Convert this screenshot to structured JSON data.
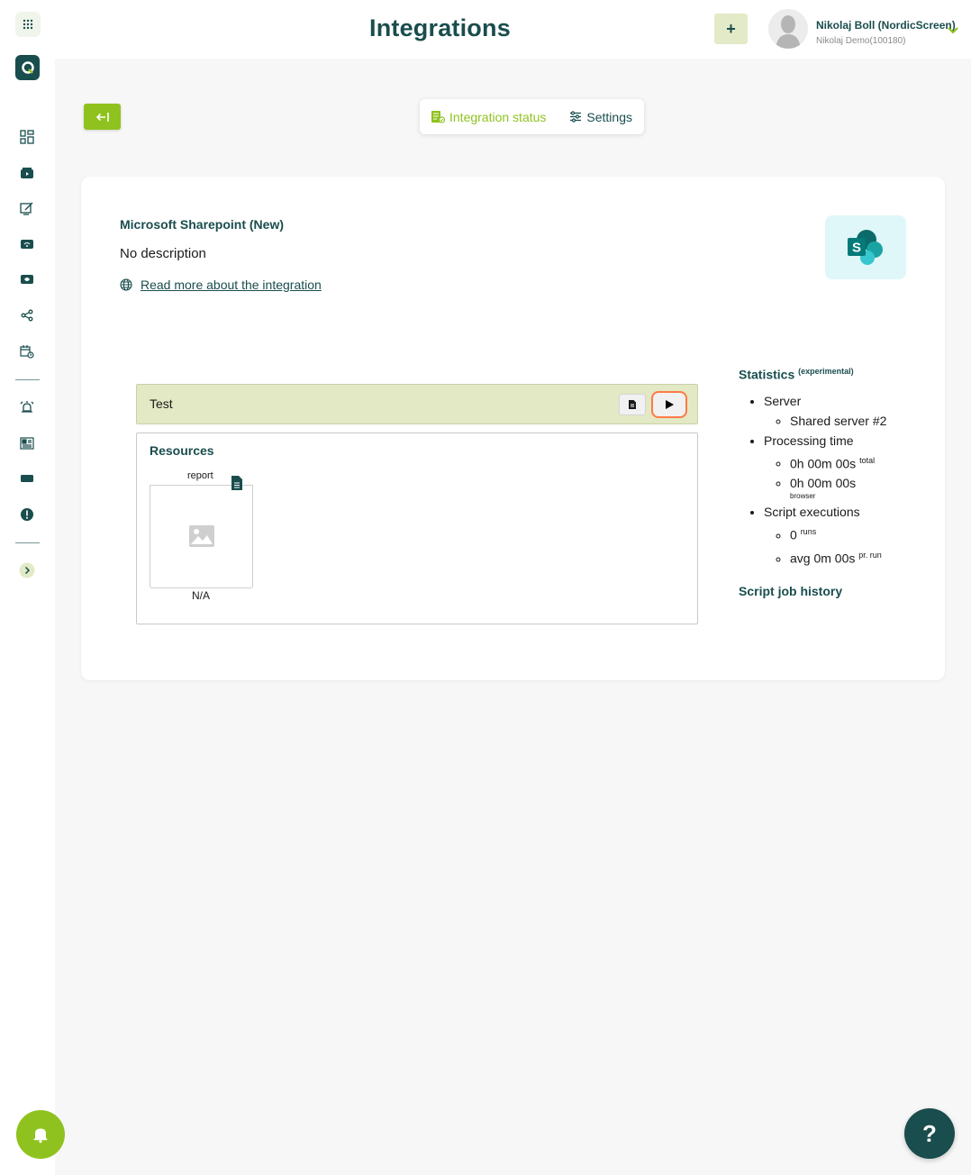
{
  "header": {
    "title": "Integrations",
    "add_label": "+",
    "user_name": "Nikolaj Boll (NordicScreen)",
    "user_org": "Nikolaj Demo(100180)"
  },
  "tabs": [
    {
      "label": "Integration status",
      "active": true
    },
    {
      "label": "Settings",
      "active": false
    }
  ],
  "integration": {
    "title": "Microsoft Sharepoint (New)",
    "description": "No description",
    "link_text": "Read more about the integration"
  },
  "test": {
    "label": "Test"
  },
  "resources": {
    "title": "Resources",
    "item_label": "report",
    "item_value": "N/A"
  },
  "stats": {
    "title": "Statistics",
    "title_sup": "(experimental)",
    "server_label": "Server",
    "server_value": "Shared server #2",
    "processing_label": "Processing time",
    "total_time": "0h 00m 00s",
    "total_sup": "total",
    "browser_time": "0h 00m 00s",
    "browser_note": "browser",
    "executions_label": "Script executions",
    "runs_value": "0",
    "runs_sup": "runs",
    "avg_value": "avg 0m 00s",
    "avg_sup": "pr. run",
    "history_link": "Script job history"
  },
  "help": {
    "label": "?"
  },
  "colors": {
    "brand_dark": "#1a4d4d",
    "brand_green": "#8fc21f",
    "highlight": "#ff7a45"
  },
  "icons": [
    "apps-grid-icon",
    "logo-icon",
    "dashboard-icon",
    "media-icon",
    "edit-screen-icon",
    "wifi-screen-icon",
    "playlist-icon",
    "share-icon",
    "schedule-icon",
    "alarm-icon",
    "news-icon",
    "display-icon",
    "alert-icon",
    "expand-icon",
    "bell-icon",
    "help-icon"
  ]
}
